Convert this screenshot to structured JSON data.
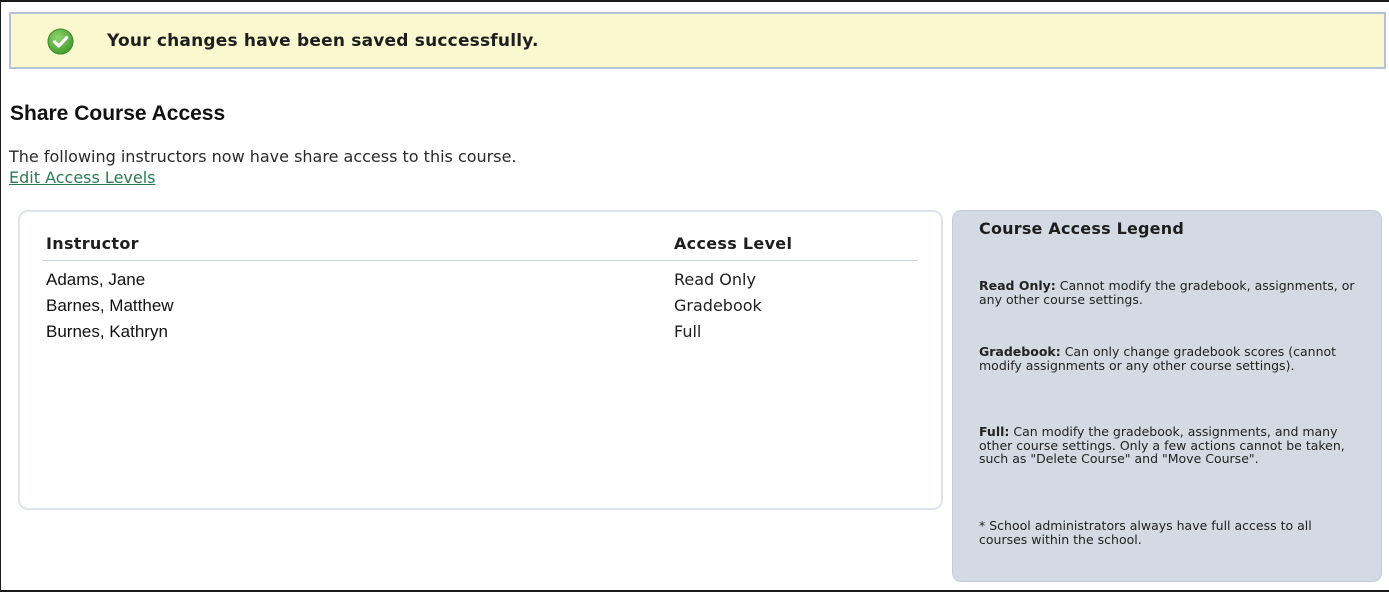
{
  "banner": {
    "icon": "check-circle-icon",
    "message": "Your changes have been saved successfully.",
    "background_color": "#fbf8d0",
    "icon_color": "#5fb042"
  },
  "page": {
    "title": "Share Course Access",
    "description": "The following instructors now have share access to this course.",
    "edit_link": "Edit Access Levels",
    "link_color": "#2b7a55"
  },
  "table": {
    "columns": [
      "Instructor",
      "Access Level"
    ],
    "rows": [
      {
        "instructor": "Adams, Jane",
        "access": "Read Only"
      },
      {
        "instructor": "Barnes, Matthew",
        "access": "Gradebook"
      },
      {
        "instructor": "Burnes, Kathryn",
        "access": "Full"
      }
    ]
  },
  "legend": {
    "title": "Course Access Legend",
    "background_color": "#d3dae3",
    "items": [
      {
        "term": "Read Only:",
        "text": " Cannot modify the gradebook, assignments, or any other course settings."
      },
      {
        "term": "Gradebook:",
        "text": " Can only change gradebook scores (cannot modify assignments or any other course settings)."
      },
      {
        "term": "Full:",
        "text": " Can modify the gradebook, assignments, and many other course settings. Only a few actions cannot be taken, such as \"Delete Course\" and \"Move Course\"."
      }
    ],
    "note": "* School administrators always have full access to all courses within the school."
  }
}
